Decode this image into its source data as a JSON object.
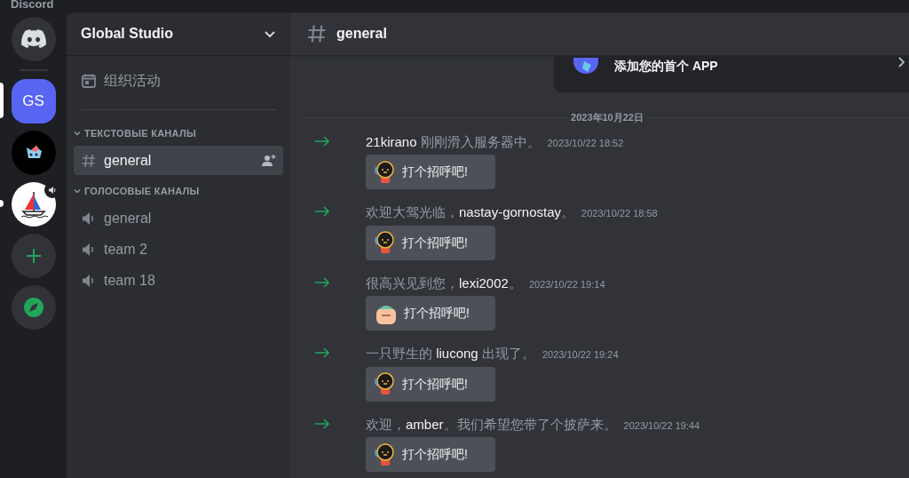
{
  "window": {
    "title": "Discord"
  },
  "servers": [
    {
      "kind": "home",
      "selected": false,
      "unread": false
    },
    {
      "kind": "initials",
      "label": "GS",
      "selected": true,
      "unread": false
    },
    {
      "kind": "avatar",
      "selected": false,
      "unread": false
    },
    {
      "kind": "avatar-boat",
      "selected": false,
      "unread": true,
      "voice": true
    },
    {
      "kind": "add",
      "selected": false,
      "unread": false
    },
    {
      "kind": "explore",
      "selected": false,
      "unread": false
    }
  ],
  "guild": {
    "name": "Global Studio",
    "events": "组织活动"
  },
  "categories": [
    {
      "name": "ТЕКСТОВЫЕ КАНАЛЫ",
      "expanded": true,
      "channels": [
        {
          "kind": "text",
          "name": "general",
          "selected": true
        }
      ]
    },
    {
      "name": "ГОЛОСОВЫЕ КАНАЛЫ",
      "expanded": true,
      "channels": [
        {
          "kind": "voice",
          "name": "general",
          "selected": false
        },
        {
          "kind": "voice",
          "name": "team 2",
          "selected": false
        },
        {
          "kind": "voice",
          "name": "team 18",
          "selected": false
        }
      ]
    }
  ],
  "channel": {
    "name": "general"
  },
  "promo": {
    "text": "添加您的首个 APP"
  },
  "date_divider": "2023年10月22日",
  "messages": [
    {
      "text": "**21kirano** 刚刚滑入服务器中。",
      "time": "2023/10/22 18:52",
      "button": "打个招呼吧!",
      "sticker": {
        "kind": "robot"
      }
    },
    {
      "text": "欢迎大驾光临，**nastay-gornostay**。",
      "time": "2023/10/22 18:58",
      "button": "打个招呼吧!",
      "sticker": {
        "kind": "robot"
      }
    },
    {
      "text": "很高兴见到您，**lexi2002**。",
      "time": "2023/10/22 19:14",
      "button": "打个招呼吧!",
      "sticker": {
        "kind": "hand"
      }
    },
    {
      "text": "一只野生的 **liucong** 出现了。",
      "time": "2023/10/22 19:24",
      "button": "打个招呼吧!",
      "sticker": {
        "kind": "robot"
      }
    },
    {
      "text": "欢迎，**amber**。我们希望您带了个披萨来。",
      "time": "2023/10/22 19:44",
      "button": "打个招呼吧!",
      "sticker": {
        "kind": "robot"
      }
    }
  ]
}
